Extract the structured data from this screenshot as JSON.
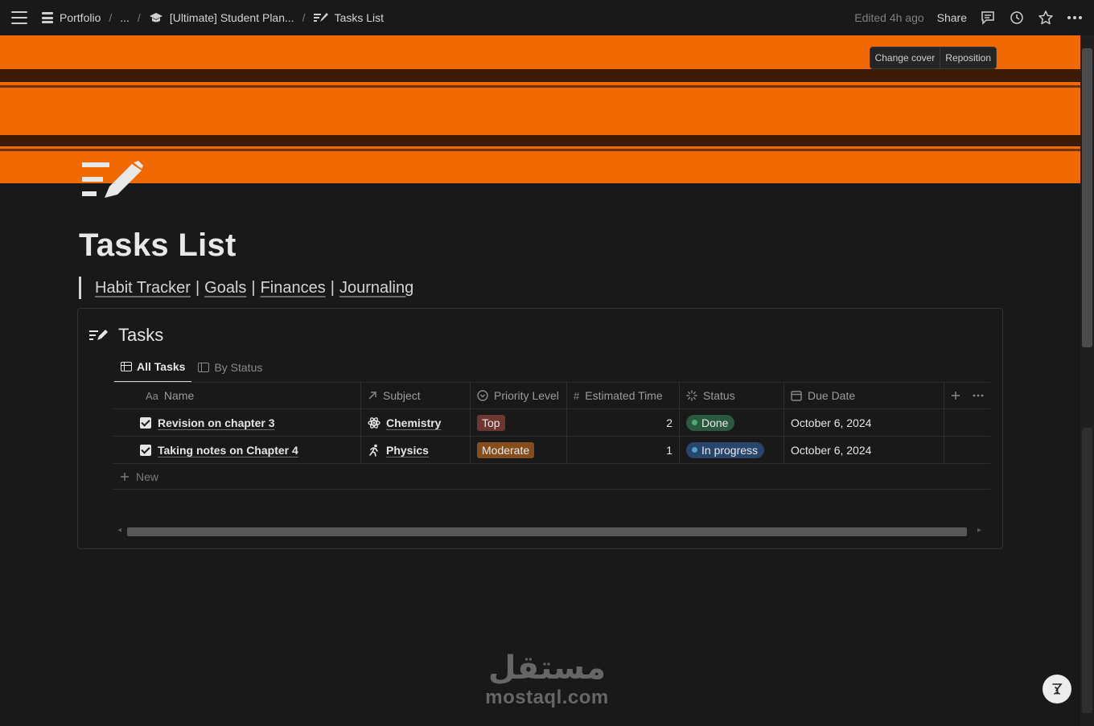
{
  "topbar": {
    "breadcrumbs": [
      "Portfolio",
      "...",
      "[Ultimate] Student Plan...",
      "Tasks List"
    ],
    "edited": "Edited 4h ago",
    "share_label": "Share",
    "icons": [
      "menu-icon",
      "page-icon",
      "graduation-cap-icon",
      "tasks-icon",
      "comments-icon",
      "clock-icon",
      "star-icon",
      "more-icon"
    ]
  },
  "cover": {
    "color": "#f06a00",
    "change_cover_label": "Change cover",
    "reposition_label": "Reposition"
  },
  "page": {
    "title": "Tasks List",
    "links": [
      "Habit Tracker",
      "Goals",
      "Finances",
      "Journaling"
    ]
  },
  "database": {
    "title": "Tasks",
    "tabs": [
      "All Tasks",
      "By Status"
    ],
    "columns": [
      {
        "label": "Name",
        "icon": "Aa"
      },
      {
        "label": "Subject",
        "icon": "relation-arrow-icon"
      },
      {
        "label": "Priority Level",
        "icon": "select-icon"
      },
      {
        "label": "Estimated Time",
        "icon": "#"
      },
      {
        "label": "Status",
        "icon": "status-spinner-icon"
      },
      {
        "label": "Due Date",
        "icon": "calendar-icon"
      }
    ],
    "rows": [
      {
        "name": "Revision on chapter 3",
        "subject": "Chemistry",
        "subject_icon": "atom-icon",
        "priority": "Top",
        "priority_color": "#6e3630",
        "estimated": "2",
        "status": "Done",
        "status_color": "#2b593f",
        "status_dot": "#4dab6f",
        "due": "October 6, 2024"
      },
      {
        "name": "Taking notes on Chapter 4",
        "subject": "Physics",
        "subject_icon": "runner-icon",
        "priority": "Moderate",
        "priority_color": "#854c1d",
        "estimated": "1",
        "status": "In progress",
        "status_color": "#28456c",
        "status_dot": "#529cca",
        "due": "October 6, 2024"
      }
    ],
    "new_label": "New"
  },
  "watermark": {
    "arabic": "مستقل",
    "latin": "mostaql.com"
  }
}
